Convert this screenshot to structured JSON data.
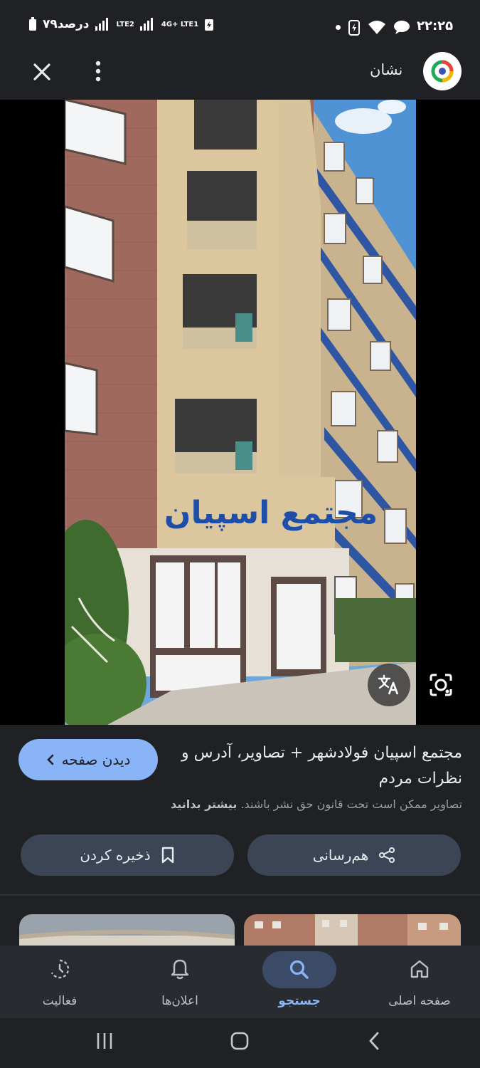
{
  "status_bar": {
    "time": "۲۲:۲۵",
    "battery_text": "۷۹درصد",
    "network_1": "LTE2",
    "network_2": "4G+ LTE1"
  },
  "app_bar": {
    "site_name": "نشان"
  },
  "image": {
    "sign_text": "مجتمع اسپیان"
  },
  "result": {
    "title": "مجتمع اسپیان فولادشهر + تصاویر، آدرس و نظرات مردم",
    "visit_label": "دیدن صفحه",
    "copyright": "تصاویر ممکن است تحت قانون حق نشر باشند.",
    "learn_more": "بیشتر بدانید",
    "save_label": "ذخیره کردن",
    "share_label": "هم‌رسانی"
  },
  "nav": {
    "home": "صفحه اصلی",
    "search": "جستجو",
    "notifications": "اعلان‌ها",
    "activity": "فعالیت"
  },
  "colors": {
    "background": "#1f2125",
    "accent": "#8ab4f8",
    "button": "#3c4556"
  }
}
